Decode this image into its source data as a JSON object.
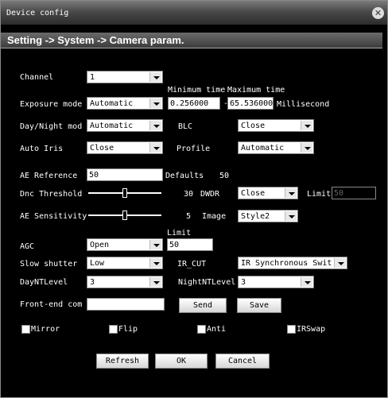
{
  "window": {
    "title": "Device config"
  },
  "breadcrumb": "Setting -> System -> Camera param.",
  "channel": {
    "label": "Channel",
    "value": "1"
  },
  "exposure": {
    "label": "Exposure mode",
    "value": "Automatic",
    "min_label": "Minimum time",
    "max_label": "Maximum time",
    "min_value": "0.256000",
    "max_value": "65.536000",
    "dash": "-",
    "unit": "Millisecond"
  },
  "daynight": {
    "label": "Day/Night mod",
    "value": "Automatic"
  },
  "blc": {
    "label": "BLC",
    "value": "Close"
  },
  "autoiris": {
    "label": "Auto Iris",
    "value": "Close"
  },
  "profile": {
    "label": "Profile",
    "value": "Automatic"
  },
  "ae_reference": {
    "label": "AE Reference",
    "value": "50",
    "defaults_label": "Defaults",
    "defaults_value": "50"
  },
  "dnc_threshold": {
    "label": "Dnc Threshold",
    "value": "30",
    "level": 30
  },
  "dwdr": {
    "label": "DWDR",
    "value": "Close",
    "limit_label": "Limit",
    "limit_value": "50"
  },
  "ae_sensitivity": {
    "label": "AE Sensitivity",
    "value": "5",
    "level": 5
  },
  "image": {
    "label": "Image",
    "value": "Style2"
  },
  "agc": {
    "label": "AGC",
    "value": "Open",
    "limit_label": "Limit",
    "limit_value": "50"
  },
  "slow_shutter": {
    "label": "Slow shutter",
    "value": "Low"
  },
  "ir_cut": {
    "label": "IR_CUT",
    "value": "IR Synchronous Switc"
  },
  "day_nt_level": {
    "label": "DayNTLevel",
    "value": "3"
  },
  "night_nt_level": {
    "label": "NightNTLevel",
    "value": "3"
  },
  "front_end": {
    "label": "Front-end com",
    "value": ""
  },
  "buttons": {
    "send": "Send",
    "save": "Save",
    "refresh": "Refresh",
    "ok": "OK",
    "cancel": "Cancel"
  },
  "checkboxes": {
    "mirror": "Mirror",
    "flip": "Flip",
    "anti": "Anti",
    "irswap": "IRSwap"
  }
}
